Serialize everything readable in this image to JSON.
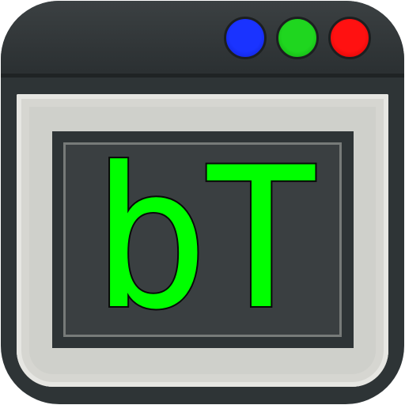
{
  "window": {
    "title_bar_buttons": [
      {
        "name": "blue-dot",
        "color": "#1a33ff"
      },
      {
        "name": "green-dot",
        "color": "#1fd61f"
      },
      {
        "name": "red-dot",
        "color": "#ff1111"
      }
    ]
  },
  "terminal": {
    "logo_text": "bT",
    "text_color": "#00ff00",
    "background_color": "#3a3f41"
  },
  "colors": {
    "frame": "#2e3436",
    "pane": "#cfd0cb"
  }
}
